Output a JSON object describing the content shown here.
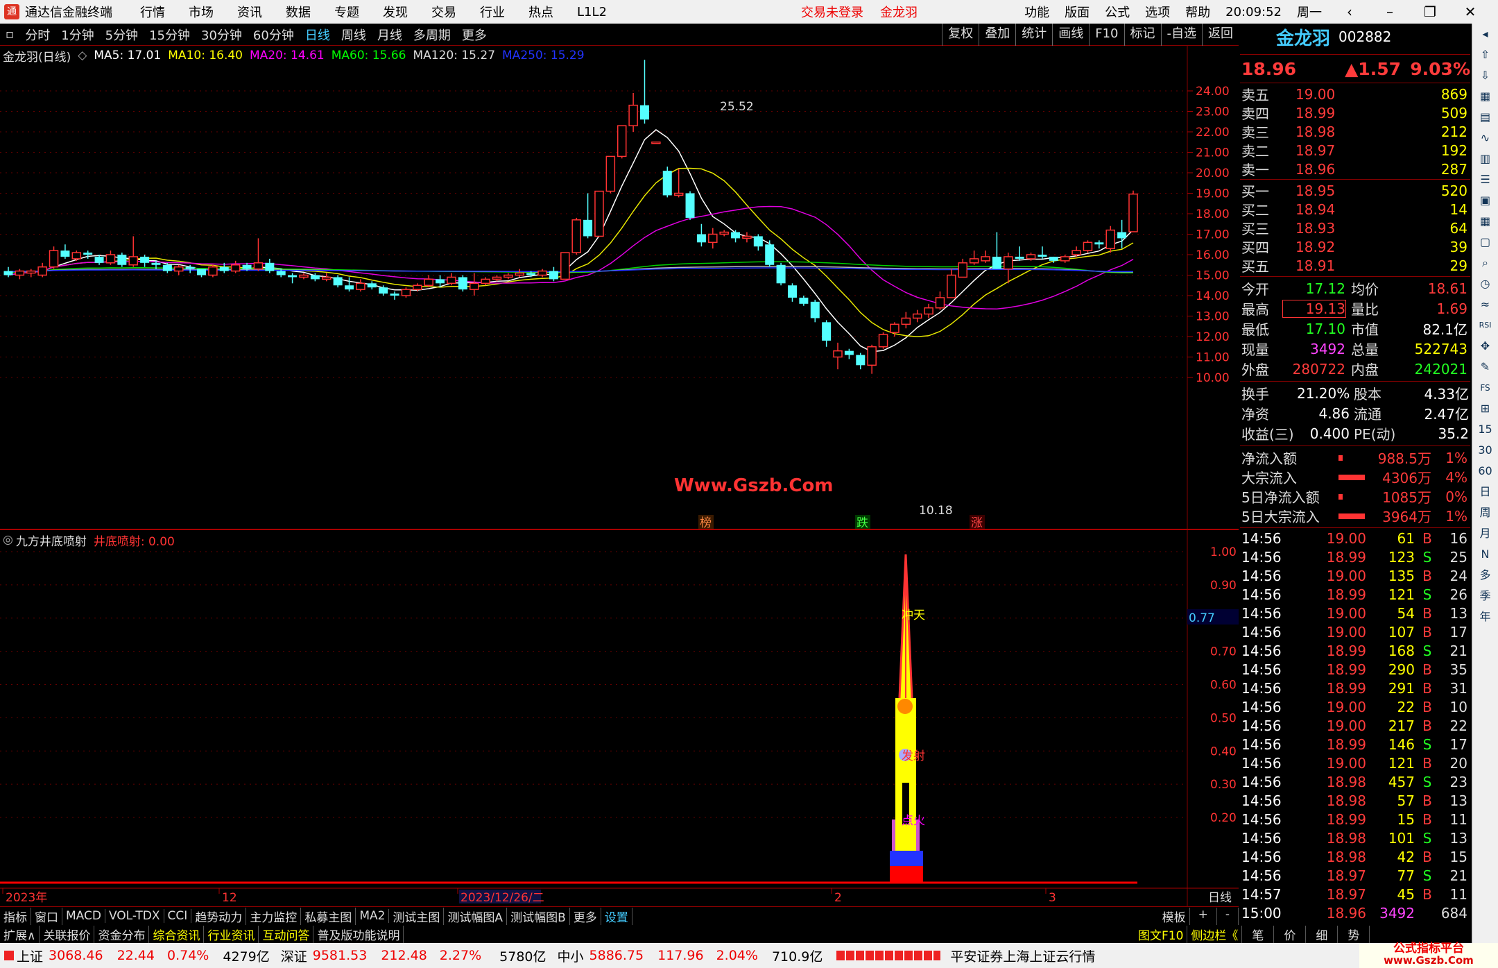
{
  "menu": {
    "app": "通达信金融终端",
    "items": [
      "行情",
      "市场",
      "资讯",
      "数据",
      "专题",
      "发现",
      "交易",
      "行业",
      "热点",
      "L1L2"
    ],
    "login": "交易未登录",
    "stock": "金龙羽",
    "right_items": [
      "功能",
      "版面",
      "公式",
      "选项",
      "帮助"
    ],
    "time": "20:09:52",
    "weekday": "周一"
  },
  "periods": [
    "分时",
    "1分钟",
    "5分钟",
    "15分钟",
    "30分钟",
    "60分钟",
    "日线",
    "周线",
    "月线",
    "多周期",
    "更多"
  ],
  "active_period": "日线",
  "tools": [
    "复权",
    "叠加",
    "统计",
    "画线",
    "F10",
    "标记",
    "-自选",
    "返回"
  ],
  "ma": {
    "title": "金龙羽(日线)",
    "ma5": "MA5: 17.01",
    "ma10": "MA10: 16.40",
    "ma20": "MA20: 14.61",
    "ma60": "MA60: 15.66",
    "ma120": "MA120: 15.27",
    "ma250": "MA250: 15.29"
  },
  "price_axis": [
    "24.00",
    "23.00",
    "22.00",
    "21.00",
    "20.00",
    "19.00",
    "18.00",
    "17.00",
    "16.00",
    "15.00",
    "14.00",
    "13.00",
    "12.00",
    "11.00",
    "10.00"
  ],
  "high_label": "25.52",
  "low_label": "10.18",
  "watermark": "Www.Gszb.Com",
  "markers": [
    "榜",
    "跌",
    "涨"
  ],
  "indicator": {
    "name": "九方井底喷射",
    "value_label": "井底喷射: 0.00",
    "axis": [
      "1.00",
      "0.90",
      "0.80",
      "0.70",
      "0.60",
      "0.50",
      "0.40",
      "0.30",
      "0.20"
    ],
    "current": "0.77",
    "labels": [
      "冲天",
      "发射",
      "点火"
    ]
  },
  "date_axis": [
    "2023年",
    "12",
    "2023/12/26/二",
    "2",
    "3"
  ],
  "date_axis_right": "日线",
  "bottom_tabs": [
    "指标",
    "窗口",
    "MACD",
    "VOL-TDX",
    "CCI",
    "趋势动力",
    "主力监控",
    "私募主图",
    "MA2",
    "测试主图",
    "测试幅图A",
    "测试幅图B",
    "更多",
    "设置"
  ],
  "bottom_tabs_right": [
    "模板",
    "+",
    "-"
  ],
  "bottom_tabs2": [
    "扩展∧",
    "关联报价",
    "资金分布",
    "综合资讯",
    "行业资讯",
    "互动问答",
    "普及版功能说明"
  ],
  "bottom_tabs2_right": [
    "图文F10",
    "侧边栏《",
    "笔",
    "价",
    "细",
    "势"
  ],
  "status": {
    "sh_name": "上证",
    "sh": "3068.46",
    "sh_chg": "22.44",
    "sh_pct": "0.74%",
    "sh_amt": "4279亿",
    "sz_name": "深证",
    "sz": "9581.53",
    "sz_chg": "212.48",
    "sz_pct": "2.27%",
    "sz_amt": "5780亿",
    "zx_name": "中小",
    "zx": "5886.75",
    "zx_chg": "117.96",
    "zx_pct": "2.04%",
    "zx_amt": "710.9亿",
    "broker": "平安证券上海上证云行情",
    "site": "公式指标平台",
    "site_url": "www.Gszb.Com"
  },
  "quote": {
    "name": "金龙羽",
    "code": "002882",
    "price": "18.96",
    "chg": "▲1.57",
    "pct": "9.03%",
    "asks": [
      [
        "卖五",
        "19.00",
        "869"
      ],
      [
        "卖四",
        "18.99",
        "509"
      ],
      [
        "卖三",
        "18.98",
        "212"
      ],
      [
        "卖二",
        "18.97",
        "192"
      ],
      [
        "卖一",
        "18.96",
        "287"
      ]
    ],
    "bids": [
      [
        "买一",
        "18.95",
        "520"
      ],
      [
        "买二",
        "18.94",
        "14"
      ],
      [
        "买三",
        "18.93",
        "64"
      ],
      [
        "买四",
        "18.92",
        "39"
      ],
      [
        "买五",
        "18.91",
        "29"
      ]
    ],
    "stats": [
      [
        "今开",
        "17.12",
        "均价",
        "18.61"
      ],
      [
        "最高",
        "19.13",
        "量比",
        "1.69"
      ],
      [
        "最低",
        "17.10",
        "市值",
        "82.1亿"
      ],
      [
        "现量",
        "3492",
        "总量",
        "522743"
      ],
      [
        "外盘",
        "280722",
        "内盘",
        "242021"
      ]
    ],
    "stats2": [
      [
        "换手",
        "21.20%",
        "股本",
        "4.33亿"
      ],
      [
        "净资",
        "4.86",
        "流通",
        "2.47亿"
      ],
      [
        "收益(三)",
        "0.400",
        "PE(动)",
        "35.2"
      ]
    ],
    "flows": [
      [
        "净流入额",
        "988.5万",
        "1%"
      ],
      [
        "大宗流入",
        "4306万",
        "4%"
      ],
      [
        "5日净流入额",
        "1085万",
        "0%"
      ],
      [
        "5日大宗流入",
        "3964万",
        "1%"
      ]
    ],
    "ticks": [
      [
        "14:56",
        "19.00",
        "61",
        "B",
        "16"
      ],
      [
        "14:56",
        "18.99",
        "123",
        "S",
        "25"
      ],
      [
        "14:56",
        "19.00",
        "135",
        "B",
        "24"
      ],
      [
        "14:56",
        "18.99",
        "121",
        "S",
        "26"
      ],
      [
        "14:56",
        "19.00",
        "54",
        "B",
        "13"
      ],
      [
        "14:56",
        "19.00",
        "107",
        "B",
        "17"
      ],
      [
        "14:56",
        "18.99",
        "168",
        "S",
        "21"
      ],
      [
        "14:56",
        "18.99",
        "290",
        "B",
        "35"
      ],
      [
        "14:56",
        "18.99",
        "291",
        "B",
        "31"
      ],
      [
        "14:56",
        "19.00",
        "22",
        "B",
        "10"
      ],
      [
        "14:56",
        "19.00",
        "217",
        "B",
        "22"
      ],
      [
        "14:56",
        "18.99",
        "146",
        "S",
        "17"
      ],
      [
        "14:56",
        "19.00",
        "121",
        "B",
        "20"
      ],
      [
        "14:56",
        "18.98",
        "457",
        "S",
        "23"
      ],
      [
        "14:56",
        "18.98",
        "57",
        "B",
        "13"
      ],
      [
        "14:56",
        "18.99",
        "15",
        "B",
        "11"
      ],
      [
        "14:56",
        "18.98",
        "101",
        "S",
        "13"
      ],
      [
        "14:56",
        "18.98",
        "42",
        "B",
        "15"
      ],
      [
        "14:56",
        "18.97",
        "77",
        "S",
        "21"
      ],
      [
        "14:57",
        "18.97",
        "45",
        "B",
        "11"
      ],
      [
        "15:00",
        "18.96",
        "3492",
        "",
        "684"
      ]
    ]
  },
  "sidebar": [
    "15",
    "30",
    "60",
    "日",
    "周",
    "月",
    "N",
    "多",
    "季",
    "年"
  ],
  "chart_data": {
    "type": "candlestick",
    "candles": [
      [
        15.2,
        15.0,
        15.4,
        14.9
      ],
      [
        15.0,
        15.2,
        15.3,
        14.8
      ],
      [
        15.1,
        15.2,
        15.3,
        14.9
      ],
      [
        15.0,
        15.4,
        15.6,
        14.9
      ],
      [
        15.4,
        16.2,
        16.4,
        15.3
      ],
      [
        16.2,
        15.9,
        16.5,
        15.8
      ],
      [
        15.8,
        16.1,
        16.2,
        15.7
      ],
      [
        16.1,
        16.0,
        16.2,
        15.8
      ],
      [
        15.9,
        15.6,
        16.0,
        15.5
      ],
      [
        15.6,
        16.0,
        16.2,
        15.5
      ],
      [
        16.0,
        15.5,
        16.1,
        15.4
      ],
      [
        15.5,
        15.9,
        16.9,
        15.4
      ],
      [
        15.9,
        15.6,
        16.0,
        15.4
      ],
      [
        15.6,
        15.5,
        15.7,
        15.3
      ],
      [
        15.5,
        15.2,
        15.6,
        15.1
      ],
      [
        15.2,
        15.4,
        15.5,
        15.0
      ],
      [
        15.4,
        15.3,
        15.5,
        15.1
      ],
      [
        15.3,
        15.0,
        15.3,
        14.9
      ],
      [
        15.0,
        15.4,
        15.5,
        14.9
      ],
      [
        15.4,
        15.2,
        15.6,
        15.1
      ],
      [
        15.2,
        15.5,
        15.7,
        15.1
      ],
      [
        15.5,
        15.3,
        15.6,
        15.2
      ],
      [
        15.3,
        15.6,
        16.8,
        15.2
      ],
      [
        15.6,
        15.2,
        15.8,
        15.1
      ],
      [
        15.2,
        15.0,
        15.3,
        14.9
      ],
      [
        15.0,
        14.9,
        15.1,
        14.6
      ],
      [
        14.9,
        15.0,
        15.1,
        14.8
      ],
      [
        15.0,
        14.8,
        15.1,
        14.7
      ],
      [
        14.8,
        14.9,
        15.1,
        14.7
      ],
      [
        14.9,
        14.5,
        15.0,
        14.4
      ],
      [
        14.5,
        14.3,
        14.9,
        14.2
      ],
      [
        14.3,
        14.6,
        14.8,
        14.2
      ],
      [
        14.6,
        14.4,
        14.7,
        14.3
      ],
      [
        14.4,
        14.1,
        14.5,
        14.0
      ],
      [
        14.1,
        14.0,
        14.2,
        13.8
      ],
      [
        14.0,
        14.3,
        14.4,
        13.9
      ],
      [
        14.3,
        14.5,
        14.6,
        14.2
      ],
      [
        14.5,
        14.8,
        15.0,
        14.4
      ],
      [
        14.8,
        14.6,
        15.0,
        14.4
      ],
      [
        14.6,
        14.9,
        15.1,
        14.5
      ],
      [
        14.9,
        14.3,
        15.0,
        14.2
      ],
      [
        14.3,
        14.6,
        15.1,
        14.0
      ],
      [
        14.6,
        14.8,
        14.9,
        14.5
      ],
      [
        14.8,
        14.9,
        15.0,
        14.7
      ],
      [
        14.9,
        15.0,
        15.1,
        14.8
      ],
      [
        15.0,
        15.1,
        15.3,
        14.9
      ],
      [
        15.1,
        15.0,
        15.2,
        14.9
      ],
      [
        15.0,
        15.2,
        15.3,
        14.9
      ],
      [
        15.2,
        14.8,
        15.4,
        14.7
      ],
      [
        14.8,
        16.1,
        16.1,
        14.8
      ],
      [
        16.1,
        17.7,
        17.8,
        16.0
      ],
      [
        17.7,
        16.9,
        19.0,
        16.8
      ],
      [
        16.9,
        19.1,
        19.1,
        16.9
      ],
      [
        19.1,
        20.8,
        20.8,
        19.0
      ],
      [
        20.8,
        22.3,
        22.3,
        20.7
      ],
      [
        22.3,
        23.3,
        23.9,
        22.0
      ],
      [
        23.3,
        22.6,
        25.52,
        22.4
      ],
      [
        21.5,
        21.5,
        21.5,
        21.5
      ],
      [
        20.1,
        18.9,
        20.3,
        18.8
      ],
      [
        18.9,
        19.0,
        20.2,
        18.8
      ],
      [
        19.0,
        17.8,
        19.1,
        17.7
      ],
      [
        17.0,
        16.6,
        17.5,
        16.4
      ],
      [
        16.6,
        17.0,
        17.3,
        16.3
      ],
      [
        17.0,
        17.1,
        17.2,
        16.9
      ],
      [
        17.1,
        16.8,
        17.2,
        16.6
      ],
      [
        16.8,
        16.9,
        17.1,
        16.6
      ],
      [
        16.9,
        16.4,
        17.0,
        16.2
      ],
      [
        16.5,
        15.5,
        16.7,
        15.4
      ],
      [
        15.5,
        14.6,
        15.6,
        14.5
      ],
      [
        14.5,
        13.9,
        14.6,
        13.7
      ],
      [
        13.9,
        13.6,
        14.0,
        13.5
      ],
      [
        13.7,
        12.9,
        13.8,
        12.7
      ],
      [
        12.7,
        11.8,
        12.8,
        11.5
      ],
      [
        11.0,
        11.3,
        11.7,
        10.4
      ],
      [
        11.3,
        11.1,
        11.4,
        10.9
      ],
      [
        11.1,
        10.6,
        11.2,
        10.4
      ],
      [
        10.6,
        11.5,
        11.6,
        10.18
      ],
      [
        11.5,
        12.1,
        12.2,
        11.4
      ],
      [
        12.2,
        12.6,
        12.7,
        12.0
      ],
      [
        12.6,
        12.9,
        13.2,
        12.4
      ],
      [
        12.9,
        13.1,
        13.3,
        12.7
      ],
      [
        13.1,
        13.4,
        13.6,
        12.9
      ],
      [
        13.4,
        13.9,
        14.2,
        13.3
      ],
      [
        13.9,
        15.0,
        15.3,
        13.9
      ],
      [
        14.9,
        15.6,
        15.8,
        14.9
      ],
      [
        15.6,
        15.8,
        16.2,
        15.5
      ],
      [
        15.7,
        15.9,
        16.2,
        15.6
      ],
      [
        15.9,
        15.3,
        17.1,
        15.3
      ],
      [
        15.3,
        15.9,
        16.1,
        14.6
      ],
      [
        15.9,
        15.8,
        16.4,
        15.7
      ],
      [
        15.8,
        16.0,
        16.1,
        15.7
      ],
      [
        16.0,
        15.9,
        16.4,
        15.8
      ],
      [
        15.9,
        15.7,
        15.9,
        15.6
      ],
      [
        15.7,
        15.9,
        16.0,
        15.6
      ],
      [
        16.0,
        16.2,
        16.4,
        15.9
      ],
      [
        16.2,
        16.6,
        16.7,
        16.1
      ],
      [
        16.6,
        16.5,
        16.7,
        16.3
      ],
      [
        16.3,
        17.2,
        17.4,
        16.1
      ],
      [
        17.1,
        16.8,
        17.7,
        16.3
      ],
      [
        17.12,
        18.96,
        19.13,
        17.1
      ]
    ]
  }
}
